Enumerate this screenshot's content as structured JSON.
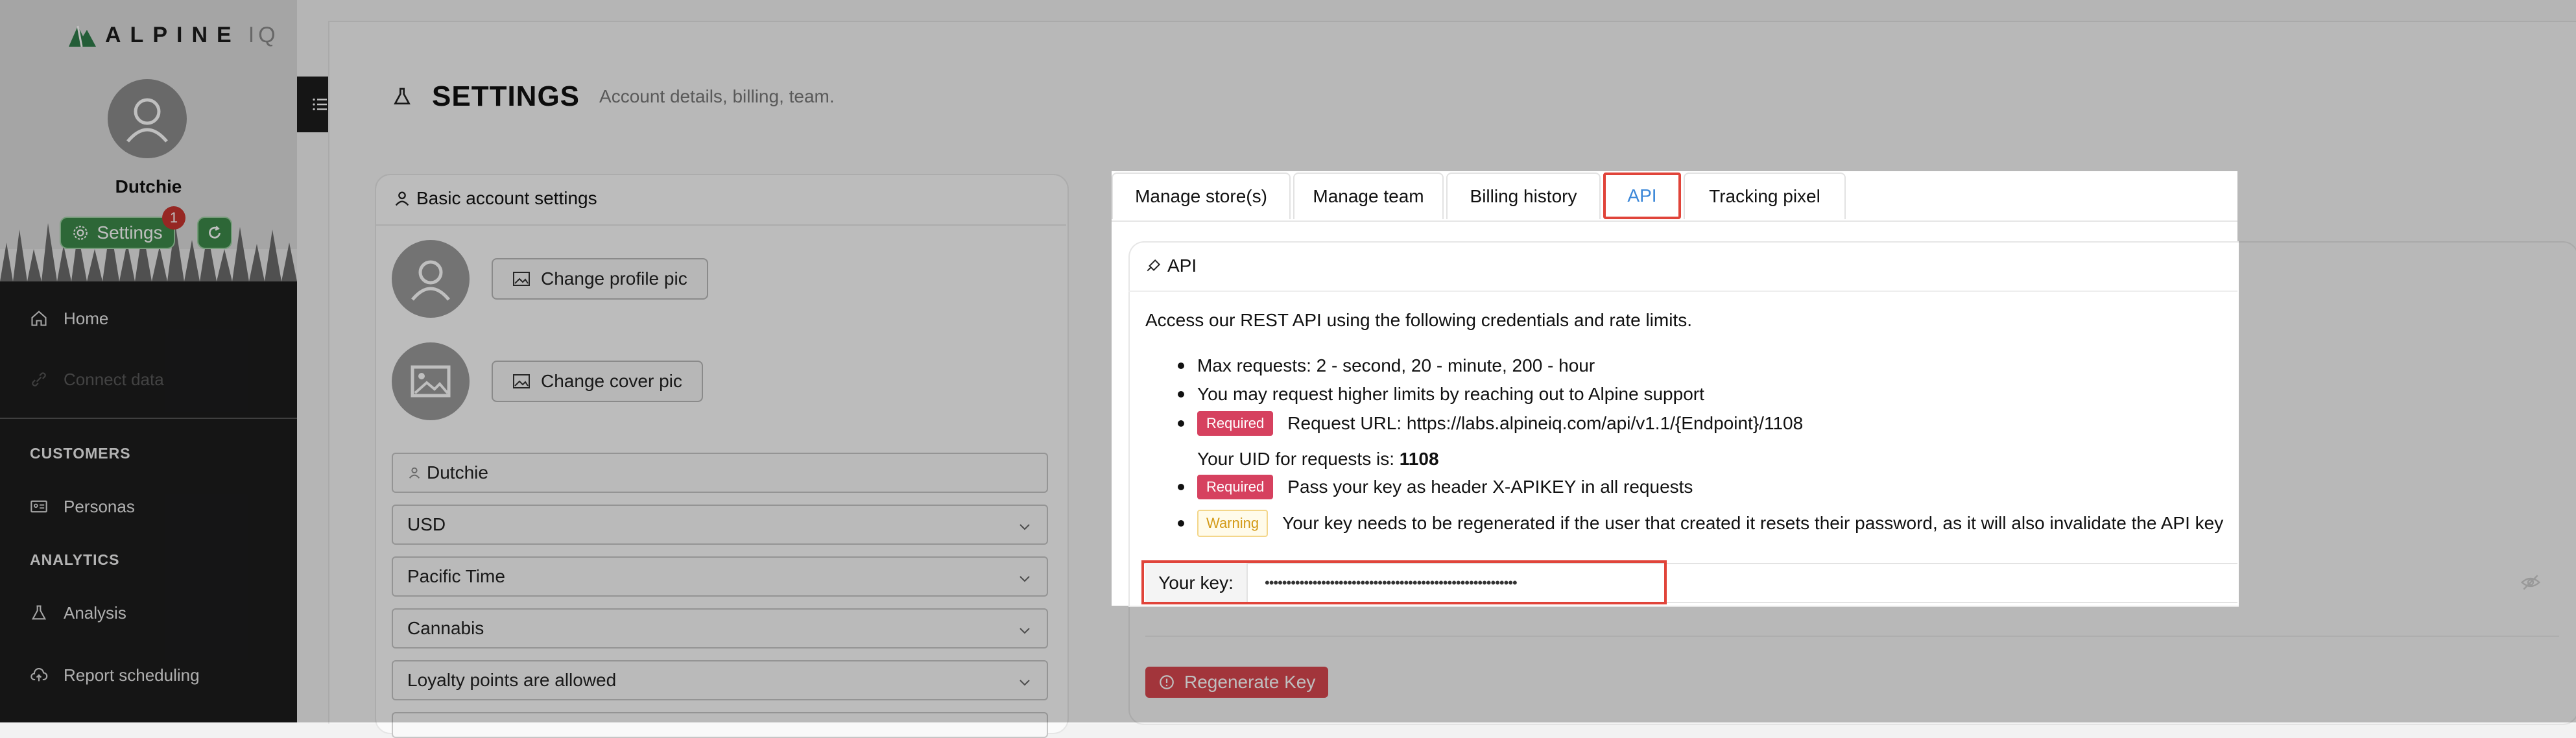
{
  "brand": {
    "logo_main": "ALPINE",
    "logo_suffix": "IQ"
  },
  "sidebar": {
    "user_name": "Dutchie",
    "settings_label": "Settings",
    "notification_count": "1",
    "items": [
      {
        "label": "Home",
        "icon": "home-icon"
      },
      {
        "label": "Connect data",
        "icon": "link-icon",
        "disabled": true
      }
    ],
    "sections": [
      {
        "title": "CUSTOMERS",
        "items": [
          {
            "label": "Personas",
            "icon": "id-card-icon"
          }
        ]
      },
      {
        "title": "ANALYTICS",
        "items": [
          {
            "label": "Analysis",
            "icon": "flask-icon"
          },
          {
            "label": "Report scheduling",
            "icon": "cloud-upload-icon"
          }
        ]
      }
    ]
  },
  "header": {
    "title": "SETTINGS",
    "subtitle": "Account details, billing, team."
  },
  "account": {
    "card_title": "Basic account settings",
    "change_profile_pic": "Change profile pic",
    "change_cover_pic": "Change cover pic",
    "name_value": "Dutchie",
    "currency_value": "USD",
    "timezone_value": "Pacific Time",
    "industry_value": "Cannabis",
    "loyalty_value": "Loyalty points are allowed"
  },
  "tabs": [
    {
      "label": "Manage store(s)",
      "active": false
    },
    {
      "label": "Manage team",
      "active": false
    },
    {
      "label": "Billing history",
      "active": false
    },
    {
      "label": "API",
      "active": true
    },
    {
      "label": "Tracking pixel",
      "active": false
    }
  ],
  "api": {
    "section_title": "API",
    "description": "Access our REST API using the following credentials and rate limits.",
    "max_requests": "Max requests: 2 - second, 20 - minute, 200 - hour",
    "higher_limits": "You may request higher limits by reaching out to Alpine support",
    "required_tag": "Required",
    "warning_tag": "Warning",
    "request_url": "Request URL: https://labs.alpineiq.com/api/v1.1/{Endpoint}/1108",
    "uid_prefix": "Your UID for requests is:",
    "uid_value": "1108",
    "pass_key": "Pass your key as header X-APIKEY in all requests",
    "warning_text": "Your key needs to be regenerated if the user that created it resets their password, as it will also invalidate the API key",
    "key_label": "Your key:",
    "key_value": "••••••••••••••••••••••••••••••••••••••••••••••••••••••••••",
    "regenerate_label": "Regenerate Key"
  },
  "colors": {
    "accent": "#3b87d8",
    "highlight": "#e0443a",
    "required": "#d6415f",
    "brand_green": "#3c8a4a"
  }
}
